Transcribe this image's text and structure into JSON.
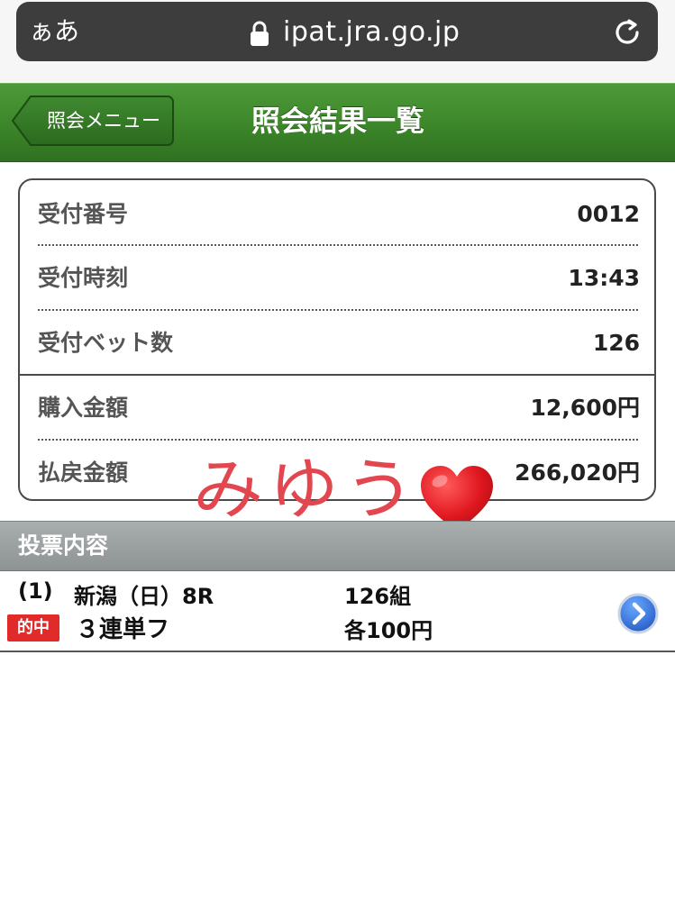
{
  "browser": {
    "text_size_label": "ぁあ",
    "url": "ipat.jra.go.jp"
  },
  "header": {
    "back_label": "照会メニュー",
    "title": "照会結果一覧"
  },
  "info": {
    "rows": [
      {
        "label": "受付番号",
        "value": "0012"
      },
      {
        "label": "受付時刻",
        "value": "13:43"
      },
      {
        "label": "受付ベット数",
        "value": "126"
      },
      {
        "label": "購入金額",
        "value": "12,600円"
      },
      {
        "label": "払戻金額",
        "value": "266,020円"
      }
    ]
  },
  "annotation": {
    "text": "みゆう"
  },
  "section": {
    "title": "投票内容"
  },
  "bet": {
    "number": "(1)",
    "race": "新潟（日）8R",
    "count": "126組",
    "badge": "的中",
    "type": "３連単フ",
    "unit": "各100円"
  },
  "colors": {
    "header_green": "#3f8a2c",
    "badge_red": "#e12a2a",
    "annotation_red": "#e2474f",
    "detail_blue": "#2f6fd6"
  }
}
